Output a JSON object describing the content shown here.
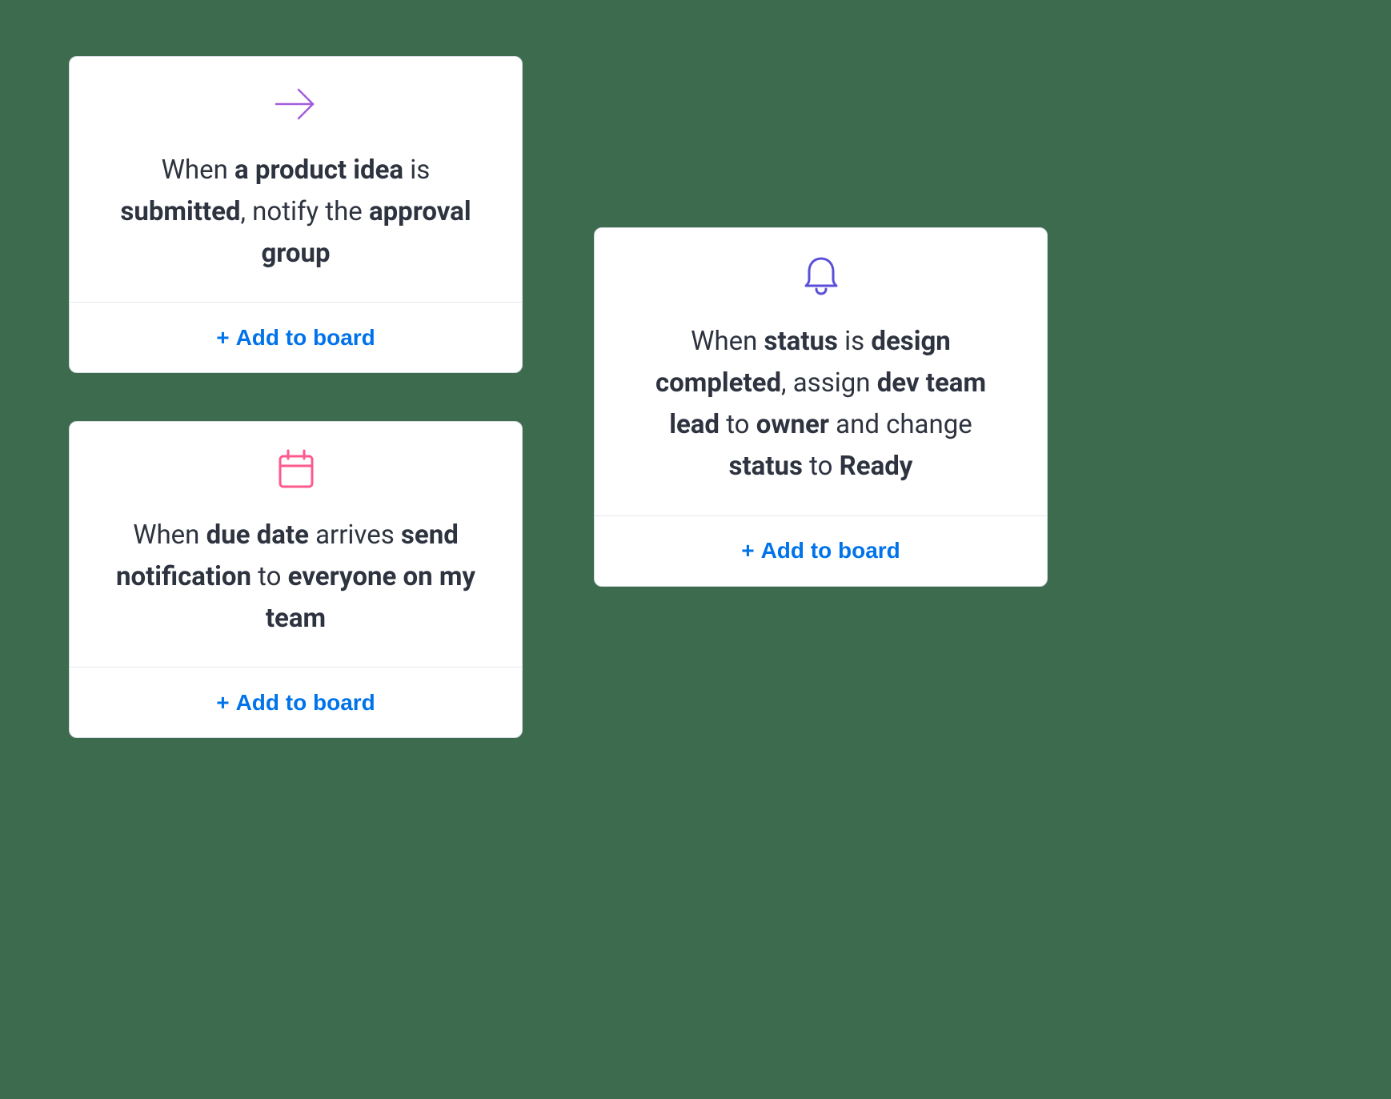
{
  "common": {
    "add_label": "Add to board"
  },
  "cards": [
    {
      "icon": "arrow-right",
      "icon_color": "#a25ddc",
      "segments": [
        {
          "t": "When ",
          "b": false
        },
        {
          "t": "a product idea",
          "b": true
        },
        {
          "t": " is ",
          "b": false
        },
        {
          "t": "submitted",
          "b": true
        },
        {
          "t": ", notify the ",
          "b": false
        },
        {
          "t": "approval group",
          "b": true
        }
      ]
    },
    {
      "icon": "calendar",
      "icon_color": "#ff5a8c",
      "segments": [
        {
          "t": "When ",
          "b": false
        },
        {
          "t": "due date",
          "b": true
        },
        {
          "t": " arrives ",
          "b": false
        },
        {
          "t": "send notification",
          "b": true
        },
        {
          "t": " to ",
          "b": false
        },
        {
          "t": "everyone on my team",
          "b": true
        }
      ]
    },
    {
      "icon": "bell",
      "icon_color": "#5b4fd9",
      "segments": [
        {
          "t": "When ",
          "b": false
        },
        {
          "t": "status",
          "b": true
        },
        {
          "t": " is ",
          "b": false
        },
        {
          "t": "design completed",
          "b": true
        },
        {
          "t": ", assign ",
          "b": false
        },
        {
          "t": "dev team lead",
          "b": true
        },
        {
          "t": " to ",
          "b": false
        },
        {
          "t": "owner",
          "b": true
        },
        {
          "t": " and change ",
          "b": false
        },
        {
          "t": "status",
          "b": true
        },
        {
          "t": " to ",
          "b": false
        },
        {
          "t": "Ready",
          "b": true
        }
      ]
    }
  ]
}
